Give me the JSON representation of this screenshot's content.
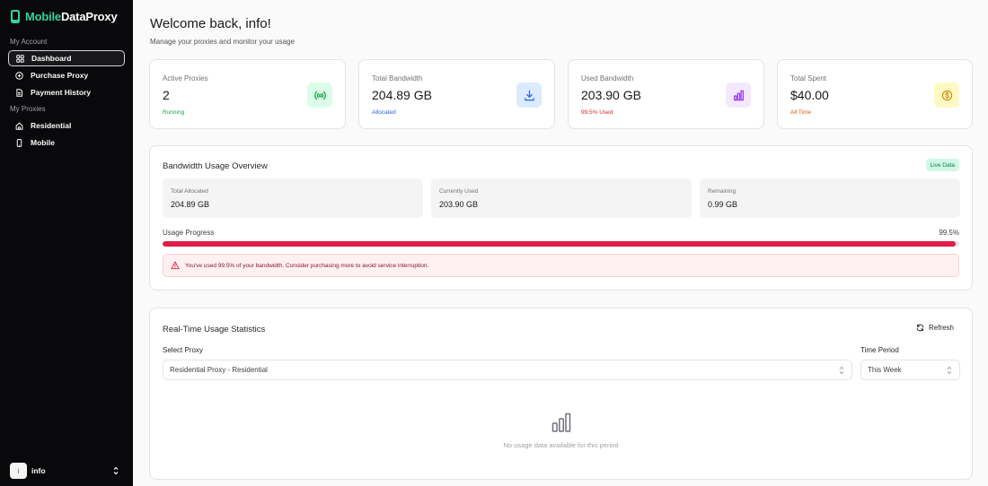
{
  "brand": {
    "prefix": "Mobile",
    "suffix": "DataProxy"
  },
  "sidebar": {
    "group_account": "My Account",
    "account_items": [
      {
        "label": "Dashboard",
        "icon": "grid-icon",
        "active": true
      },
      {
        "label": "Purchase Proxy",
        "icon": "plus-circle-icon"
      },
      {
        "label": "Payment History",
        "icon": "document-icon"
      }
    ],
    "group_proxies": "My Proxies",
    "proxy_items": [
      {
        "label": "Residential",
        "icon": "home-icon"
      },
      {
        "label": "Mobile",
        "icon": "smartphone-icon"
      }
    ],
    "user": {
      "initial": "i",
      "name": "info"
    }
  },
  "header": {
    "title": "Welcome back, info!",
    "subtitle": "Manage your proxies and monitor your usage"
  },
  "stats": [
    {
      "title": "Active Proxies",
      "value": "2",
      "note": "Running",
      "icon": "signal-icon",
      "note_color": "#16a34a",
      "icon_bg": "#dcfce7",
      "icon_color": "#16a34a"
    },
    {
      "title": "Total Bandwidth",
      "value": "204.89 GB",
      "note": "Allocated",
      "icon": "download-icon",
      "note_color": "#2563eb",
      "icon_bg": "#dbeafe",
      "icon_color": "#2563eb"
    },
    {
      "title": "Used Bandwidth",
      "value": "203.90 GB",
      "note": "99.5% Used",
      "icon": "bar-chart-icon",
      "note_color": "#dc2626",
      "icon_bg": "#f3e8ff",
      "icon_color": "#9333ea"
    },
    {
      "title": "Total Spent",
      "value": "$40.00",
      "note": "All Time",
      "icon": "dollar-icon",
      "note_color": "#ea580c",
      "icon_bg": "#fef9c3",
      "icon_color": "#ca8a04"
    }
  ],
  "bandwidth": {
    "title": "Bandwidth Usage Overview",
    "badge": "Live Data",
    "items": [
      {
        "label": "Total Allocated",
        "value": "204.89 GB"
      },
      {
        "label": "Currently Used",
        "value": "203.90 GB"
      },
      {
        "label": "Remaining",
        "value": "0.99 GB"
      }
    ],
    "progress_label": "Usage Progress",
    "progress_text": "99.5%",
    "progress_value": 0.995,
    "alert": "You've used 99.5% of your bandwidth. Consider purchasing more to avoid service interruption."
  },
  "usage": {
    "title": "Real-Time Usage Statistics",
    "refresh_label": "Refresh",
    "proxy_label": "Select Proxy",
    "proxy_value": "Residential Proxy - Residential",
    "period_label": "Time Period",
    "period_value": "This Week",
    "empty_text": "No usage data available for this period"
  }
}
